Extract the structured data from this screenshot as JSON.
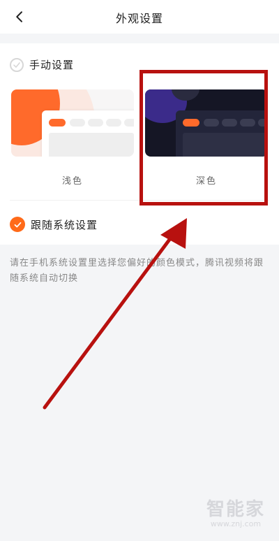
{
  "header": {
    "title": "外观设置",
    "back_icon": "chevron-left-icon"
  },
  "appearance": {
    "manual_option_label": "手动设置",
    "manual_option_selected": false,
    "themes": [
      {
        "label": "浅色",
        "selected": false
      },
      {
        "label": "深色",
        "selected": false
      }
    ],
    "follow_system_label": "跟随系统设置",
    "follow_system_selected": true
  },
  "description": "请在手机系统设置里选择您偏好的颜色模式，腾讯视频将跟随系统自动切换",
  "watermark": {
    "title": "智能家",
    "url": "www.znj.com"
  },
  "colors": {
    "accent": "#ff6a19",
    "annotation": "#b8110f"
  }
}
